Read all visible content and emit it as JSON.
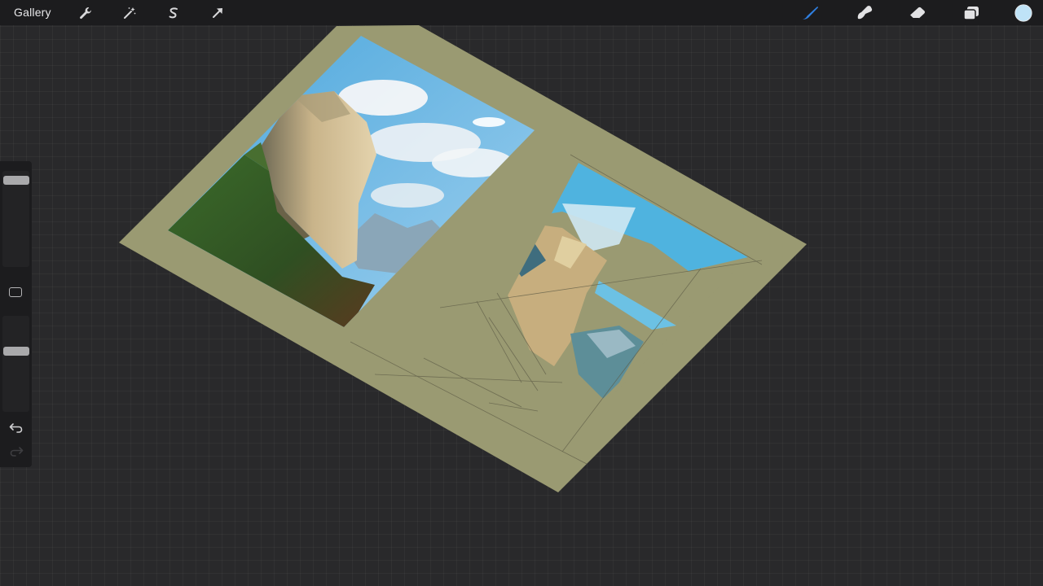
{
  "app": {
    "gallery_label": "Gallery"
  },
  "toolbar_left": [
    {
      "name": "actions-wrench-icon"
    },
    {
      "name": "adjustments-wand-icon"
    },
    {
      "name": "selection-s-icon"
    },
    {
      "name": "transform-arrow-icon"
    }
  ],
  "toolbar_right": [
    {
      "name": "brush-icon",
      "active": true
    },
    {
      "name": "smudge-icon",
      "active": false
    },
    {
      "name": "eraser-icon",
      "active": false
    },
    {
      "name": "layers-icon",
      "active": false
    },
    {
      "name": "color-swatch",
      "active": false
    }
  ],
  "sidebar": {
    "brush_size_level": 0.96,
    "brush_opacity_level": 0.66
  },
  "colors": {
    "accent_active": "#2f7fe0",
    "current_color": "#bfe3f7",
    "paper": "#9a9a72",
    "toolbar_bg": "#1c1c1e",
    "canvas_bg": "#29292b"
  }
}
